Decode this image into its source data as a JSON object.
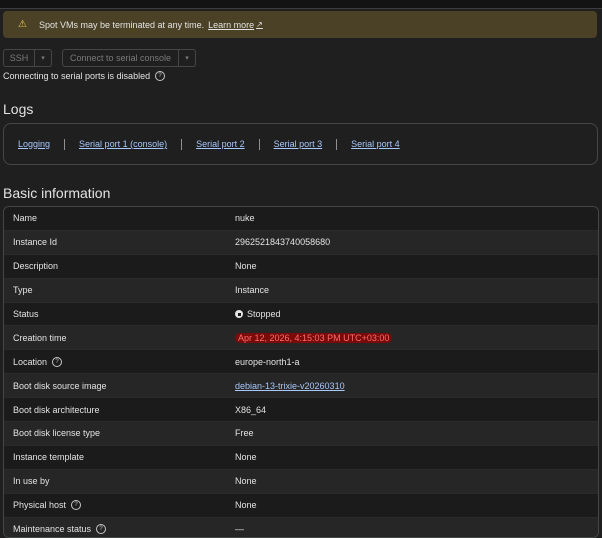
{
  "banner": {
    "warning_icon": "⚠",
    "text": "Spot VMs may be terminated at any time.",
    "link": "Learn more",
    "ext_icon": "↗"
  },
  "toolbar": {
    "ssh_label": "SSH",
    "serial_label": "Connect to serial console",
    "dropdown_glyph": "▾",
    "serial_disabled_text": "Connecting to serial ports is disabled",
    "help_glyph": "?"
  },
  "logs": {
    "heading": "Logs",
    "links": [
      "Logging",
      "Serial port 1 (console)",
      "Serial port 2",
      "Serial port 3",
      "Serial port 4"
    ]
  },
  "basic": {
    "heading": "Basic information",
    "rows": [
      {
        "key": "Name",
        "value": "nuke"
      },
      {
        "key": "Instance Id",
        "value": "2962521843740058680"
      },
      {
        "key": "Description",
        "value": "None"
      },
      {
        "key": "Type",
        "value": "Instance"
      },
      {
        "key": "Status",
        "value": "Stopped"
      },
      {
        "key": "Creation time",
        "value": "Apr 12, 2026, 4:15:03 PM UTC+03:00"
      },
      {
        "key": "Location",
        "value": "europe-north1-a"
      },
      {
        "key": "Boot disk source image",
        "value": "debian-13-trixie-v20260310"
      },
      {
        "key": "Boot disk architecture",
        "value": "X86_64"
      },
      {
        "key": "Boot disk license type",
        "value": "Free"
      },
      {
        "key": "Instance template",
        "value": "None"
      },
      {
        "key": "In use by",
        "value": "None"
      },
      {
        "key": "Physical host",
        "value": "None"
      },
      {
        "key": "Maintenance status",
        "value": "—"
      }
    ]
  },
  "colors": {
    "link": "#a8c7fa",
    "warning_bg": "#4a4126",
    "redacted_bg": "#7a0b0b"
  }
}
